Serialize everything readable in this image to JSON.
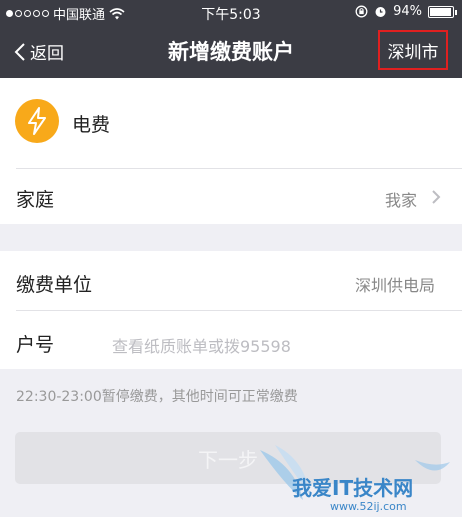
{
  "status_bar": {
    "carrier": "中国联通",
    "time": "下午5:03",
    "battery": "94%",
    "icons": [
      "signal-dots",
      "wifi-icon",
      "rotation-lock-icon",
      "alarm-icon",
      "battery-icon"
    ]
  },
  "navbar": {
    "back_label": "返回",
    "title": "新增缴费账户",
    "city": "深圳市"
  },
  "bill_type": {
    "icon": "lightning-icon",
    "label": "电费"
  },
  "group": {
    "label": "家庭",
    "value": "我家"
  },
  "payee": {
    "label": "缴费单位",
    "value": "深圳供电局"
  },
  "account": {
    "label": "户号",
    "placeholder": "查看纸质账单或拨95598"
  },
  "notice": "22:30-23:00暂停缴费，其他时间可正常缴费",
  "next_button": "下一步",
  "watermark": {
    "text": "我爱IT技术网",
    "url": "www.52ij.com"
  },
  "colors": {
    "nav_bg": "#3b3c44",
    "accent_orange": "#f8a91a",
    "highlight_red": "#e02020",
    "page_bg": "#efeff4"
  }
}
